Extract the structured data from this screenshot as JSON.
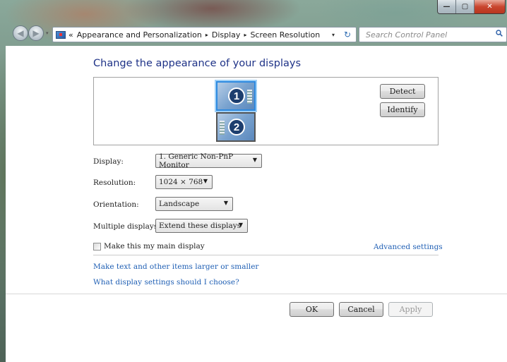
{
  "window": {
    "minimize_glyph": "—",
    "maximize_glyph": "▢",
    "close_glyph": "✕"
  },
  "nav": {
    "back_glyph": "◀",
    "forward_glyph": "▶",
    "history_glyph": "▾"
  },
  "address": {
    "overflow": "«",
    "breadcrumb": [
      "Appearance and Personalization",
      "Display",
      "Screen Resolution"
    ],
    "separator": "▸",
    "dropdown_glyph": "▾",
    "refresh_glyph": "↻"
  },
  "search": {
    "placeholder": "Search Control Panel"
  },
  "page": {
    "title": "Change the appearance of your displays"
  },
  "monitors": [
    {
      "number": "1",
      "selected": true
    },
    {
      "number": "2",
      "selected": false
    }
  ],
  "monitor_buttons": {
    "detect": "Detect",
    "identify": "Identify"
  },
  "settings": {
    "display_label": "Display:",
    "display_value": "1. Generic Non-PnP Monitor",
    "resolution_label": "Resolution:",
    "resolution_value": "1024 × 768",
    "orientation_label": "Orientation:",
    "orientation_value": "Landscape",
    "multiple_label": "Multiple displays:",
    "multiple_value": "Extend these displays",
    "dropdown_glyph": "▼"
  },
  "main_display": {
    "label": "Make this my main display",
    "checked": false
  },
  "links": {
    "advanced": "Advanced settings",
    "larger_text": "Make text and other items larger or smaller",
    "which_settings": "What display settings should I choose?"
  },
  "footer": {
    "ok": "OK",
    "cancel": "Cancel",
    "apply": "Apply"
  }
}
